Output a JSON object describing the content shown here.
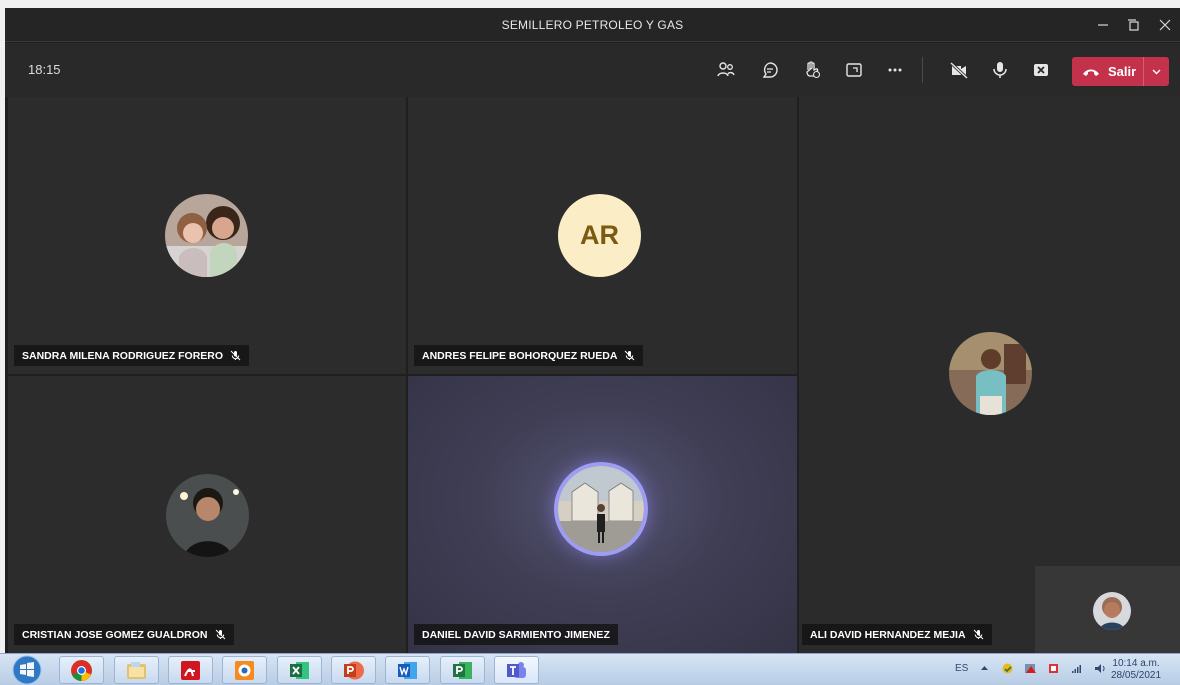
{
  "window": {
    "title": "SEMILLERO PETROLEO Y GAS",
    "controls": [
      "minimize-icon",
      "maximize-icon",
      "close-icon"
    ]
  },
  "toolbar": {
    "timer": "18:15",
    "icons": [
      "participants-icon",
      "chat-icon",
      "raise-hand-icon",
      "share-tray-icon",
      "more-actions-icon",
      "camera-off-icon",
      "microphone-icon",
      "stop-sharing-icon"
    ],
    "leave_label": "Salir",
    "leave_color": "#c4314b"
  },
  "participants": [
    {
      "name": "SANDRA MILENA RODRIGUEZ FORERO",
      "muted": true
    },
    {
      "name": "ANDRES FELIPE BOHORQUEZ RUEDA",
      "initials": "AR",
      "muted": true
    },
    {
      "name": "ALI DAVID HERNANDEZ MEJIA",
      "muted": true
    },
    {
      "name": "CRISTIAN JOSE GOMEZ GUALDRON",
      "muted": true
    },
    {
      "name": "DANIEL DAVID SARMIENTO JIMENEZ",
      "muted": false,
      "speaking": true
    }
  ],
  "taskbar": {
    "apps": [
      "windows-start-icon",
      "chrome-icon",
      "file-explorer-icon",
      "acrobat-icon",
      "media-player-icon",
      "excel-icon",
      "powerpoint-icon",
      "word-icon",
      "project-icon",
      "teams-icon"
    ],
    "language": "ES",
    "time": "10:14 a.m.",
    "date": "28/05/2021"
  }
}
